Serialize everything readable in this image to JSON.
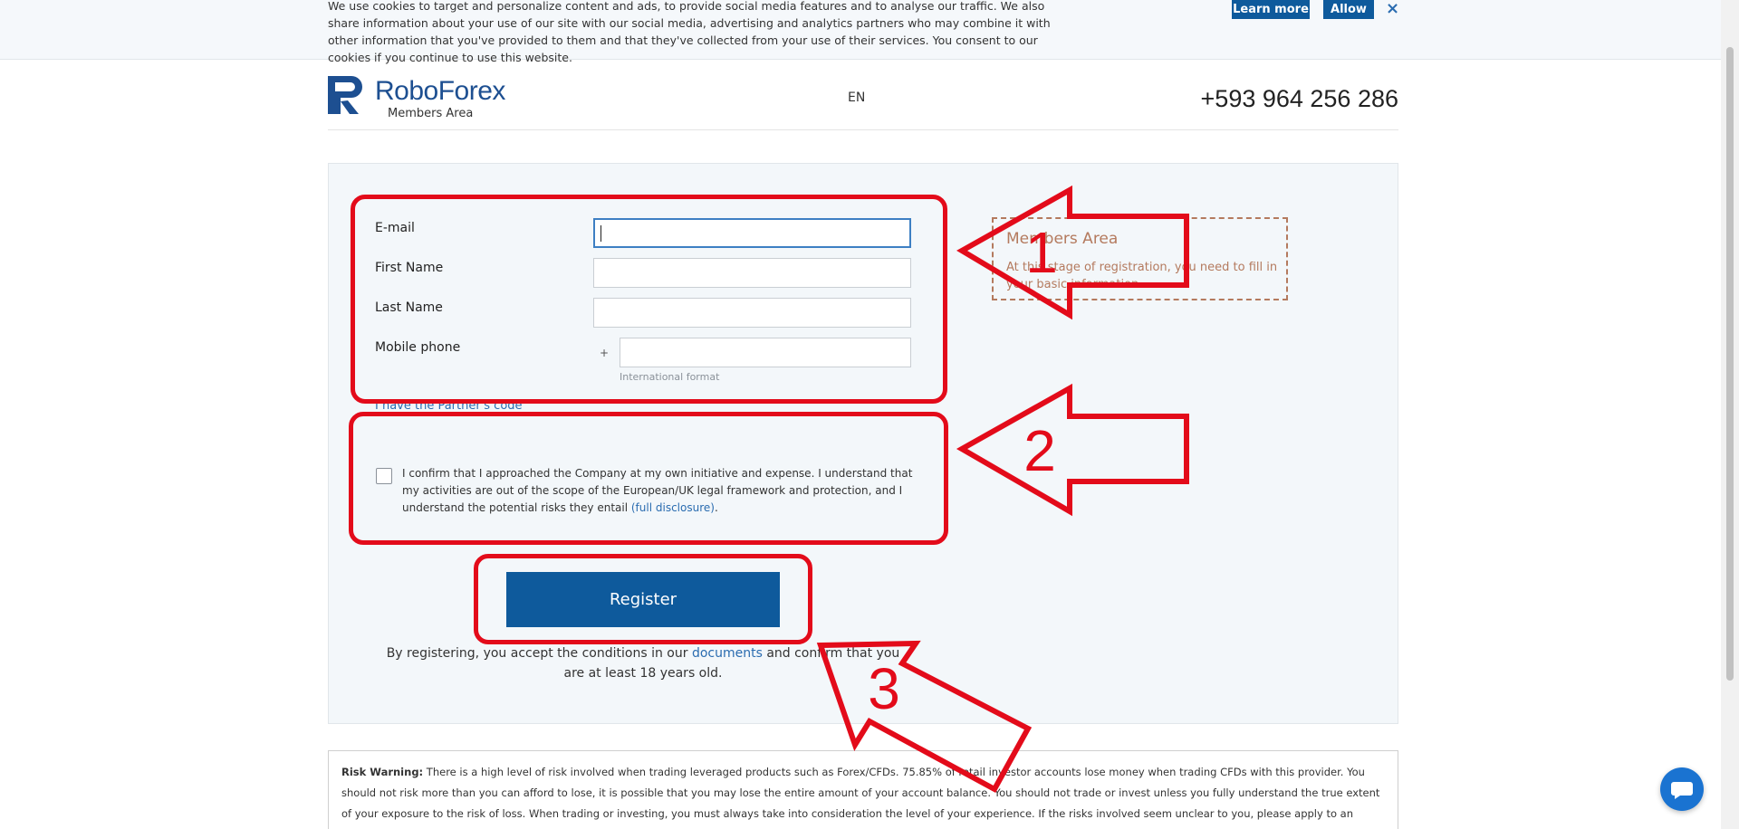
{
  "cookie": {
    "text": "We use cookies to target and personalize content and ads, to provide social media features and to analyse our traffic. We also share information about your use of our site with our social media, advertising and analytics partners who may combine it with other information that you've provided to them and that they've collected from your use of their services. You consent to our cookies if you continue to use this website.",
    "learn_more": "Learn more",
    "allow": "Allow",
    "close": "×"
  },
  "header": {
    "brand": "RoboForex",
    "brand_sub": "Members Area",
    "lang": "EN",
    "phone": "+593 964 256 286"
  },
  "form": {
    "email_label": "E-mail",
    "first_name_label": "First Name",
    "last_name_label": "Last Name",
    "mobile_label": "Mobile phone",
    "phone_plus": "+",
    "phone_hint": "International format",
    "partner_link": "I have the Partner's code",
    "confirm_text": "I confirm that I approached the Company at my own initiative and expense. I understand that my activities are out of the scope of the European/UK legal framework and protection, and I understand the potential risks they entail ",
    "confirm_link": "(full disclosure)",
    "confirm_end": ".",
    "register": "Register",
    "terms_before": "By registering, you accept the conditions in our ",
    "terms_link": "documents",
    "terms_after": " and confirm that you are at least 18 years old."
  },
  "info": {
    "title": "Members Area",
    "text": "At this stage of registration, you need to fill in your basic information."
  },
  "risk": {
    "label": "Risk Warning:",
    "text": " There is a high level of risk involved when trading leveraged products such as Forex/CFDs. 75.85% of retail investor accounts lose money when trading CFDs with this provider. You should not risk more than you can afford to lose, it is possible that you may lose the entire amount of your account balance. You should not trade or invest unless you fully understand the true extent of your exposure to the risk of loss. When trading or investing, you must always take into consideration the level of your experience. If the risks involved seem unclear to you, please apply to an outside specialist for an independent advice. RoboForex Ltd and it partner do"
  },
  "annotations": {
    "n1": "1",
    "n2": "2",
    "n3": "3",
    "color": "#e30b1a"
  },
  "colors": {
    "brand": "#1d4f91",
    "button": "#0e5a9c",
    "link": "#2a6cb0"
  }
}
